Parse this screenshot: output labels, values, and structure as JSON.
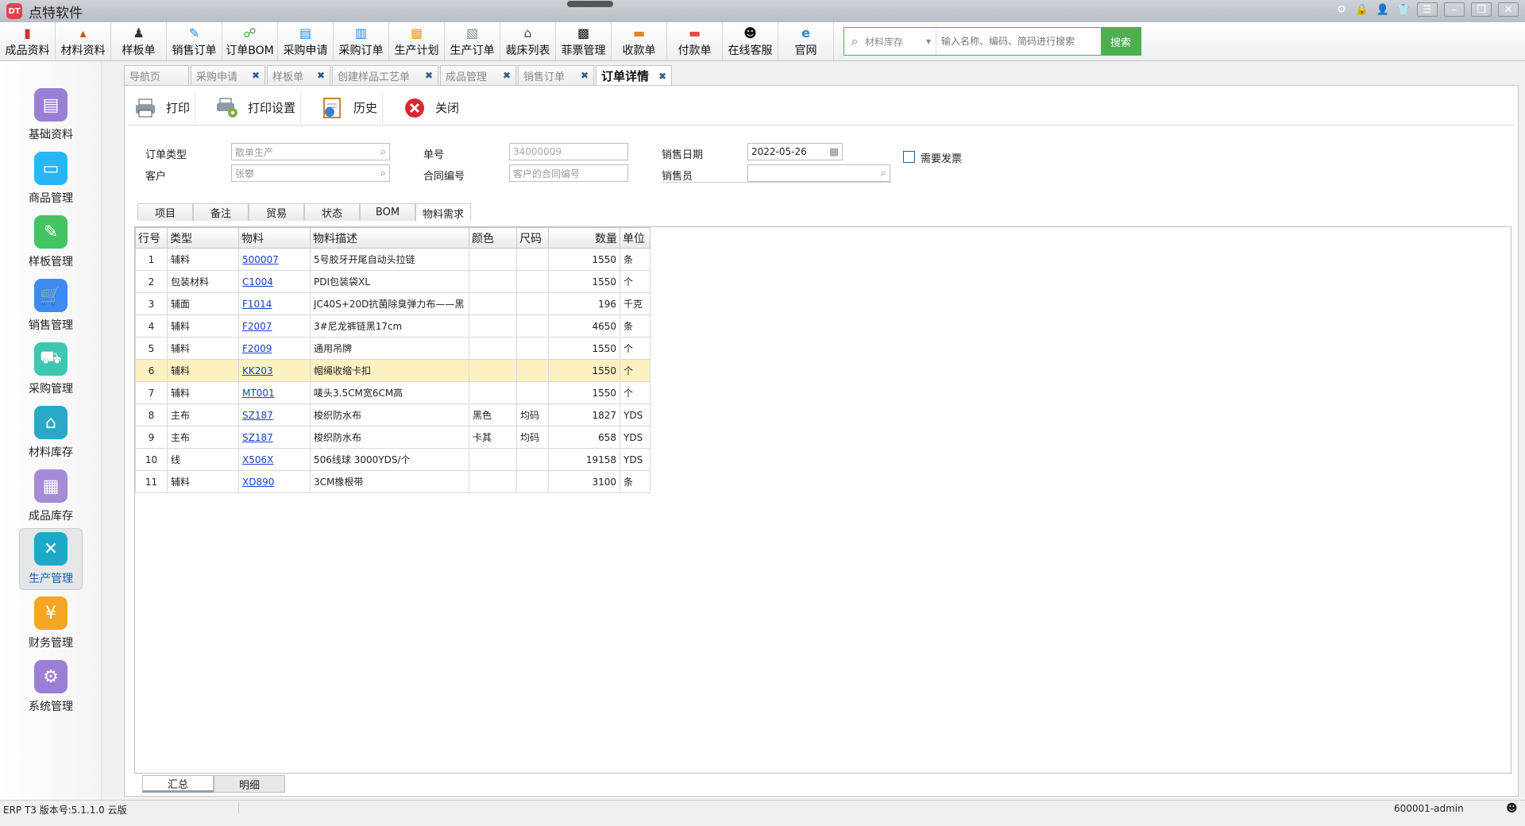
{
  "app": {
    "title": "点特软件",
    "logo_text": "DT"
  },
  "colors": {
    "accent_green": "#4caf50",
    "link_blue": "#1a3fc9",
    "selected_row": "#fdf1c2"
  },
  "toolbar": {
    "items": [
      {
        "label": "成品资料",
        "icon": "product-icon"
      },
      {
        "label": "材料资料",
        "icon": "material-icon"
      },
      {
        "label": "样板单",
        "icon": "sample-icon"
      },
      {
        "label": "销售订单",
        "icon": "sales-order-icon"
      },
      {
        "label": "订单BOM",
        "icon": "bom-icon"
      },
      {
        "label": "采购申请",
        "icon": "purchase-request-icon"
      },
      {
        "label": "采购订单",
        "icon": "purchase-order-icon"
      },
      {
        "label": "生产计划",
        "icon": "production-plan-icon"
      },
      {
        "label": "生产订单",
        "icon": "production-order-icon"
      },
      {
        "label": "裁床列表",
        "icon": "cutting-icon"
      },
      {
        "label": "菲票管理",
        "icon": "qrcode-icon"
      },
      {
        "label": "收款单",
        "icon": "receipt-icon"
      },
      {
        "label": "付款单",
        "icon": "payment-icon"
      },
      {
        "label": "在线客服",
        "icon": "qq-icon"
      },
      {
        "label": "官网",
        "icon": "ie-icon"
      }
    ],
    "search": {
      "scope": "材料库存",
      "placeholder": "输入名称、编码、简码进行搜索",
      "button": "搜索"
    }
  },
  "sidebar": {
    "items": [
      {
        "label": "基础资料",
        "color": "#9b7fd6"
      },
      {
        "label": "商品管理",
        "color": "#29b6f6"
      },
      {
        "label": "样板管理",
        "color": "#43c463"
      },
      {
        "label": "销售管理",
        "color": "#3d8bf0"
      },
      {
        "label": "采购管理",
        "color": "#3fc6b0"
      },
      {
        "label": "材料库存",
        "color": "#2aa8c8"
      },
      {
        "label": "成品库存",
        "color": "#a58bd8"
      },
      {
        "label": "生产管理",
        "color": "#1fa9c9"
      },
      {
        "label": "财务管理",
        "color": "#f5a623"
      },
      {
        "label": "系统管理",
        "color": "#9b7fd6"
      }
    ]
  },
  "tabs": [
    {
      "label": "导航页",
      "closable": false
    },
    {
      "label": "采购申请",
      "closable": true
    },
    {
      "label": "样板单",
      "closable": true
    },
    {
      "label": "创建样品工艺单",
      "closable": true
    },
    {
      "label": "成品管理",
      "closable": true
    },
    {
      "label": "销售订单",
      "closable": true
    },
    {
      "label": "订单详情",
      "closable": true
    }
  ],
  "actions": {
    "print": "打印",
    "print_settings": "打印设置",
    "history": "历史",
    "close": "关闭"
  },
  "form": {
    "order_type_label": "订单类型",
    "order_type_value": "散单生产",
    "customer_label": "客户",
    "customer_value": "张攀",
    "order_no_label": "单号",
    "order_no_value": "34000009",
    "contract_label": "合同编号",
    "contract_placeholder": "客户的合同编号",
    "sale_date_label": "销售日期",
    "sale_date_value": "2022-05-26",
    "salesperson_label": "销售员",
    "salesperson_value": "",
    "invoice_label": "需要发票"
  },
  "subtabs": [
    "项目",
    "备注",
    "贸易",
    "状态",
    "BOM",
    "物料需求"
  ],
  "table": {
    "headers": [
      "行号",
      "类型",
      "物料",
      "物料描述",
      "颜色",
      "尺码",
      "数量",
      "单位"
    ],
    "rows": [
      {
        "no": "1",
        "type": "辅料",
        "code": "500007",
        "desc": "5号胶牙开尾自动头拉链",
        "color": "",
        "size": "",
        "qty": "1550",
        "unit": "条"
      },
      {
        "no": "2",
        "type": "包装材料",
        "code": "C1004",
        "desc": "PDI包装袋XL",
        "color": "",
        "size": "",
        "qty": "1550",
        "unit": "个"
      },
      {
        "no": "3",
        "type": "辅面",
        "code": "F1014",
        "desc": "JC40S+20D抗菌除臭弹力布——黑",
        "color": "",
        "size": "",
        "qty": "196",
        "unit": "千克"
      },
      {
        "no": "4",
        "type": "辅料",
        "code": "F2007",
        "desc": "3#尼龙裤链黑17cm",
        "color": "",
        "size": "",
        "qty": "4650",
        "unit": "条"
      },
      {
        "no": "5",
        "type": "辅料",
        "code": "F2009",
        "desc": "通用吊牌",
        "color": "",
        "size": "",
        "qty": "1550",
        "unit": "个"
      },
      {
        "no": "6",
        "type": "辅料",
        "code": "KK203",
        "desc": "帽绳收缩卡扣",
        "color": "",
        "size": "",
        "qty": "1550",
        "unit": "个"
      },
      {
        "no": "7",
        "type": "辅料",
        "code": "MT001",
        "desc": "唛头3.5CM宽6CM高",
        "color": "",
        "size": "",
        "qty": "1550",
        "unit": "个"
      },
      {
        "no": "8",
        "type": "主布",
        "code": "SZ187",
        "desc": "梭织防水布",
        "color": "黑色",
        "size": "均码",
        "qty": "1827",
        "unit": "YDS"
      },
      {
        "no": "9",
        "type": "主布",
        "code": "SZ187",
        "desc": "梭织防水布",
        "color": "卡其",
        "size": "均码",
        "qty": "658",
        "unit": "YDS"
      },
      {
        "no": "10",
        "type": "线",
        "code": "X506X",
        "desc": "506线球 3000YDS/个",
        "color": "",
        "size": "",
        "qty": "19158",
        "unit": "YDS"
      },
      {
        "no": "11",
        "type": "辅料",
        "code": "XD890",
        "desc": "3CM橡根带",
        "color": "",
        "size": "",
        "qty": "3100",
        "unit": "条"
      }
    ]
  },
  "bottom_tabs": [
    "汇总",
    "明细"
  ],
  "status": {
    "version": "ERP T3 版本号:5.1.1.0 云版",
    "user": "600001-admin"
  }
}
